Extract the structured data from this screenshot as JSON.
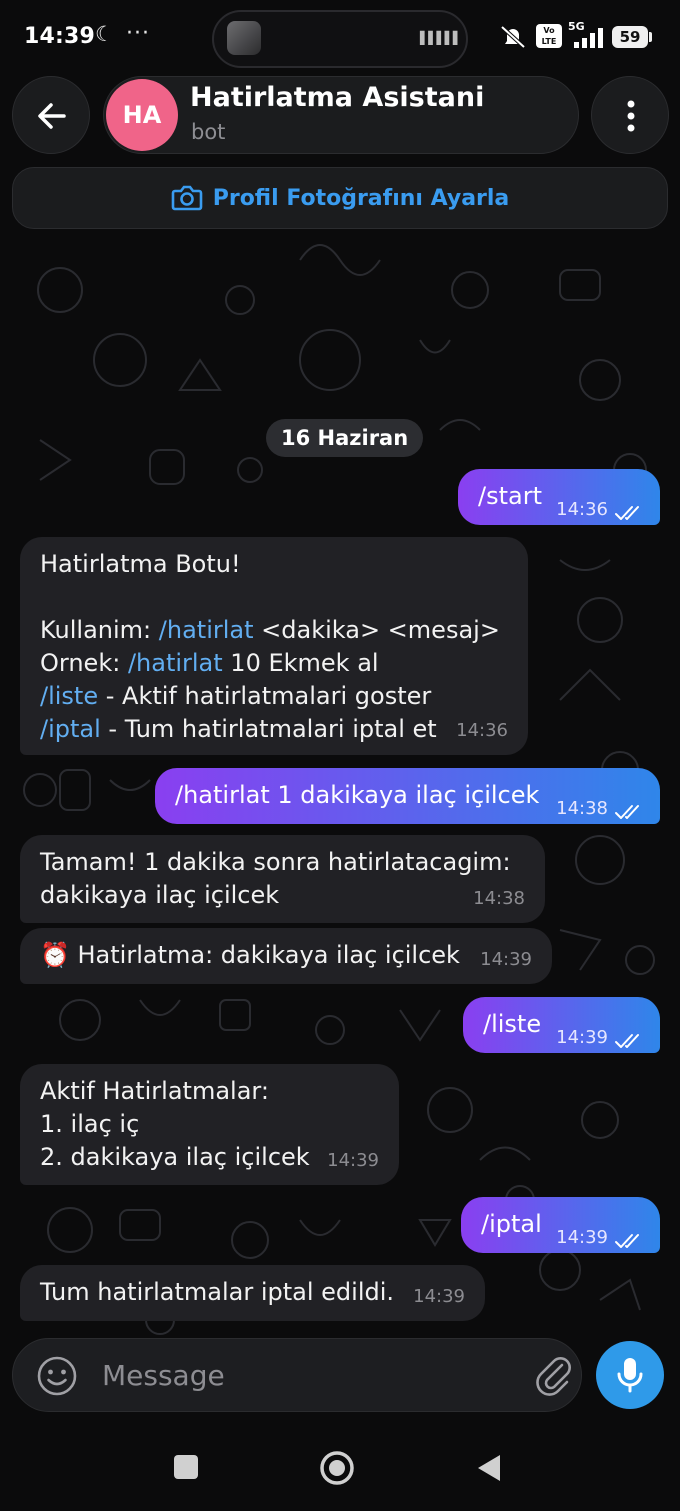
{
  "status_bar": {
    "time": "14:39",
    "moon_icon": "☾",
    "dots": "···",
    "network": "5G",
    "volte": "Vo LTE",
    "battery": "59"
  },
  "header": {
    "avatar_initials": "HA",
    "title": "Hatirlatma Asistani",
    "subtitle": "bot",
    "avatar_color": "#f06489"
  },
  "profile_banner": {
    "label": "Profil Fotoğrafını Ayarla",
    "icon": "camera-icon",
    "color": "#3a9cf0"
  },
  "date_separator": "16 Haziran",
  "messages": [
    {
      "dir": "out",
      "text": "/start",
      "time": "14:36"
    },
    {
      "dir": "in",
      "lines": [
        [
          {
            "t": "Hatirlatma Botu!"
          }
        ],
        [],
        [
          {
            "t": "Kullanim: "
          },
          {
            "t": "/hatirlat",
            "cmd": true
          },
          {
            "t": " <dakika> <mesaj>"
          }
        ],
        [
          {
            "t": "Ornek: "
          },
          {
            "t": "/hatirlat",
            "cmd": true
          },
          {
            "t": " 10 Ekmek al"
          }
        ],
        [
          {
            "t": "/liste",
            "cmd": true
          },
          {
            "t": " - Aktif hatirlatmalari goster"
          }
        ],
        [
          {
            "t": "/iptal",
            "cmd": true
          },
          {
            "t": " - Tum hatirlatmalari iptal et"
          }
        ]
      ],
      "time": "14:36"
    },
    {
      "dir": "out",
      "text": "/hatirlat 1 dakikaya ilaç içilcek",
      "time": "14:38"
    },
    {
      "dir": "in",
      "lines": [
        [
          {
            "t": "Tamam! 1 dakika sonra hatirlatacagim:"
          }
        ],
        [
          {
            "t": "dakikaya ilaç içilcek"
          }
        ]
      ],
      "time": "14:38"
    },
    {
      "dir": "in",
      "lines": [
        [
          {
            "t": "⏰ Hatirlatma: dakikaya ilaç içilcek"
          }
        ]
      ],
      "time": "14:39"
    },
    {
      "dir": "out",
      "text": "/liste",
      "time": "14:39"
    },
    {
      "dir": "in",
      "lines": [
        [
          {
            "t": "Aktif Hatirlatmalar:"
          }
        ],
        [
          {
            "t": "1. ilaç iç"
          }
        ],
        [
          {
            "t": "2. dakikaya ilaç içilcek"
          }
        ]
      ],
      "time": "14:39"
    },
    {
      "dir": "out",
      "text": "/iptal",
      "time": "14:39"
    },
    {
      "dir": "in",
      "lines": [
        [
          {
            "t": "Tum hatirlatmalar iptal edildi."
          }
        ]
      ],
      "time": "14:39"
    }
  ],
  "composer": {
    "placeholder": "Message",
    "emoji_icon": "smile-icon",
    "attach_icon": "paperclip-icon",
    "mic_icon": "microphone-icon"
  },
  "colors": {
    "outgoing_bubble_start": "#8a3ff0",
    "outgoing_bubble_end": "#2f86ea",
    "incoming_bubble": "#212125",
    "command_link": "#62aef1",
    "background": "#0b0b0c"
  }
}
